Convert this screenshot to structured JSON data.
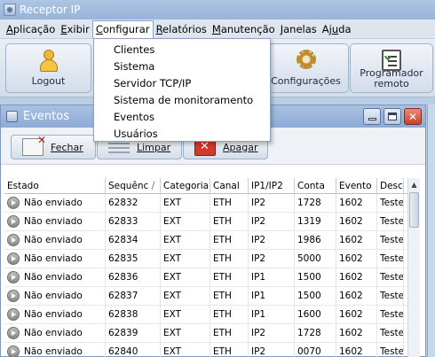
{
  "window": {
    "title": "Receptor IP"
  },
  "menubar": {
    "items": [
      {
        "label": "Aplicação",
        "id": "aplicacao"
      },
      {
        "label": "Exibir",
        "id": "exibir"
      },
      {
        "label": "Configurar",
        "id": "configurar"
      },
      {
        "label": "Relatórios",
        "id": "relatorios"
      },
      {
        "label": "Manutenção",
        "id": "manutencao"
      },
      {
        "label": "Janelas",
        "id": "janelas"
      },
      {
        "label": "Ajuda",
        "id": "ajuda"
      }
    ]
  },
  "toolbar": {
    "logout_label": "Logout",
    "configuracoes_label": "Configurações",
    "programador_label_line1": "Programador",
    "programador_label_line2": "remoto"
  },
  "configurar_menu": {
    "items": [
      "Clientes",
      "Sistema",
      "Servidor TCP/IP",
      "Sistema de monitoramento",
      "Eventos",
      "Usuários"
    ]
  },
  "eventos_window": {
    "title": "Eventos",
    "fechar_label": "Fechar",
    "limpar_label": "Limpar",
    "apagar_label": "Apagar",
    "columns": [
      "Estado",
      "Sequênc",
      "Categoria",
      "Canal",
      "IP1/IP2",
      "Conta",
      "Evento",
      "Descr"
    ],
    "sort_glyph": "/",
    "rows": [
      [
        "Não enviado",
        "62832",
        "EXT",
        "ETH",
        "IP2",
        "1728",
        "1602",
        "Teste"
      ],
      [
        "Não enviado",
        "62833",
        "EXT",
        "ETH",
        "IP2",
        "1319",
        "1602",
        "Teste"
      ],
      [
        "Não enviado",
        "62834",
        "EXT",
        "ETH",
        "IP2",
        "1986",
        "1602",
        "Teste"
      ],
      [
        "Não enviado",
        "62835",
        "EXT",
        "ETH",
        "IP2",
        "5000",
        "1602",
        "Teste"
      ],
      [
        "Não enviado",
        "62836",
        "EXT",
        "ETH",
        "IP1",
        "1500",
        "1602",
        "Teste"
      ],
      [
        "Não enviado",
        "62837",
        "EXT",
        "ETH",
        "IP1",
        "1500",
        "1602",
        "Teste"
      ],
      [
        "Não enviado",
        "62838",
        "EXT",
        "ETH",
        "IP1",
        "1600",
        "1602",
        "Teste"
      ],
      [
        "Não enviado",
        "62839",
        "EXT",
        "ETH",
        "IP2",
        "1728",
        "1602",
        "Teste"
      ],
      [
        "Não enviado",
        "62840",
        "EXT",
        "ETH",
        "IP2",
        "0070",
        "1602",
        "Teste"
      ]
    ]
  }
}
